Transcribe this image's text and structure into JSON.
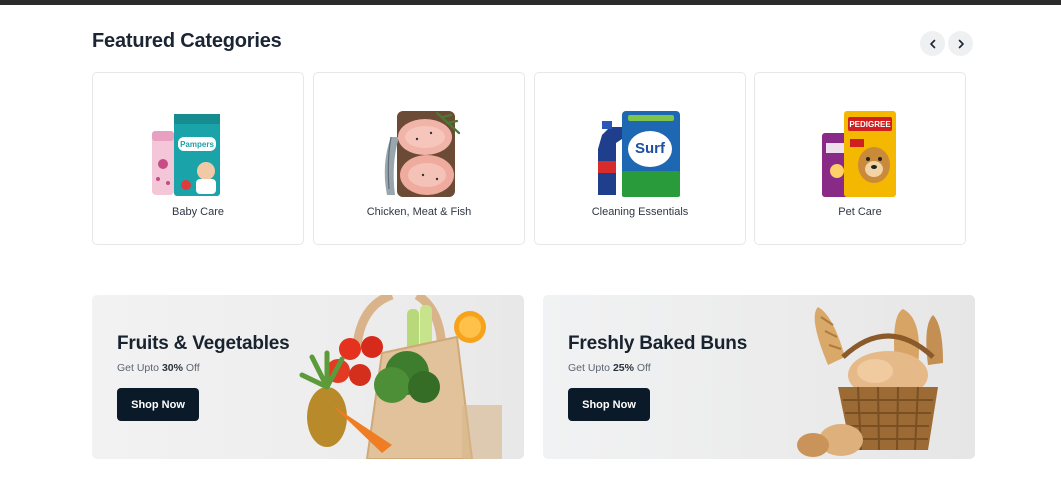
{
  "section": {
    "title": "Featured Categories"
  },
  "nav": {
    "prev_icon": "chevron-left-icon",
    "next_icon": "chevron-right-icon"
  },
  "categories": [
    {
      "label": "Baby Care",
      "icon": "diapers-image"
    },
    {
      "label": "Chicken, Meat & Fish",
      "icon": "chicken-meat-image"
    },
    {
      "label": "Cleaning Essentials",
      "icon": "detergent-image"
    },
    {
      "label": "Pet Care",
      "icon": "pet-food-image"
    }
  ],
  "banners": [
    {
      "title": "Fruits & Vegetables",
      "sub_prefix": "Get Upto ",
      "discount": "30%",
      "sub_suffix": " Off",
      "button": "Shop Now"
    },
    {
      "title": "Freshly Baked Buns",
      "sub_prefix": "Get Upto ",
      "discount": "25%",
      "sub_suffix": " Off",
      "button": "Shop Now"
    }
  ],
  "colors": {
    "button_bg": "#0b1a28",
    "title": "#1b2533",
    "card_border": "#e5e7eb"
  }
}
